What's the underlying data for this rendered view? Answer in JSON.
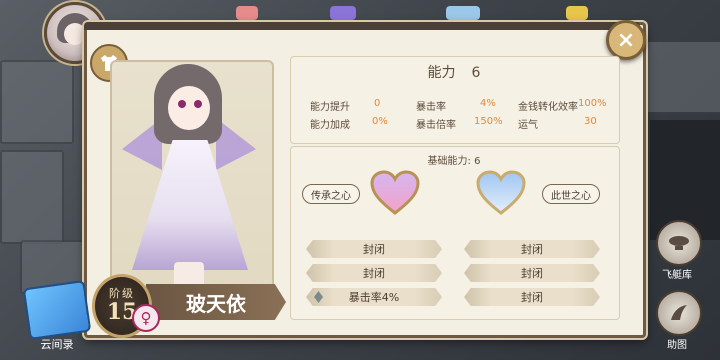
{
  "header": {
    "close_glyph": "×"
  },
  "character": {
    "name": "玻天依",
    "level_label": "阶级",
    "level": "15",
    "gender_glyph": "♀"
  },
  "ability": {
    "title": "能力",
    "value": "6",
    "stats": [
      {
        "label": "能力提升",
        "value": "0"
      },
      {
        "label": "暴击率",
        "value": "4%"
      },
      {
        "label": "金钱转化效率",
        "value": "100%"
      },
      {
        "label": "能力加成",
        "value": "0%"
      },
      {
        "label": "暴击倍率",
        "value": "150%"
      },
      {
        "label": "运气",
        "value": "30"
      }
    ]
  },
  "base_ability": {
    "title": "基础能力: 6",
    "left_heart": "传承之心",
    "right_heart": "此世之心",
    "left_slots": [
      "封闭",
      "封闭",
      "暴击率4%"
    ],
    "right_slots": [
      "封闭",
      "封闭",
      "封闭"
    ]
  },
  "side_buttons": {
    "airship": "飞艇库",
    "illustration": "助图"
  },
  "scroll": {
    "label": "云间录"
  },
  "colors": {
    "accent": "#e08a3a",
    "panel": "#f4efe3",
    "frame": "#6d5a45"
  }
}
